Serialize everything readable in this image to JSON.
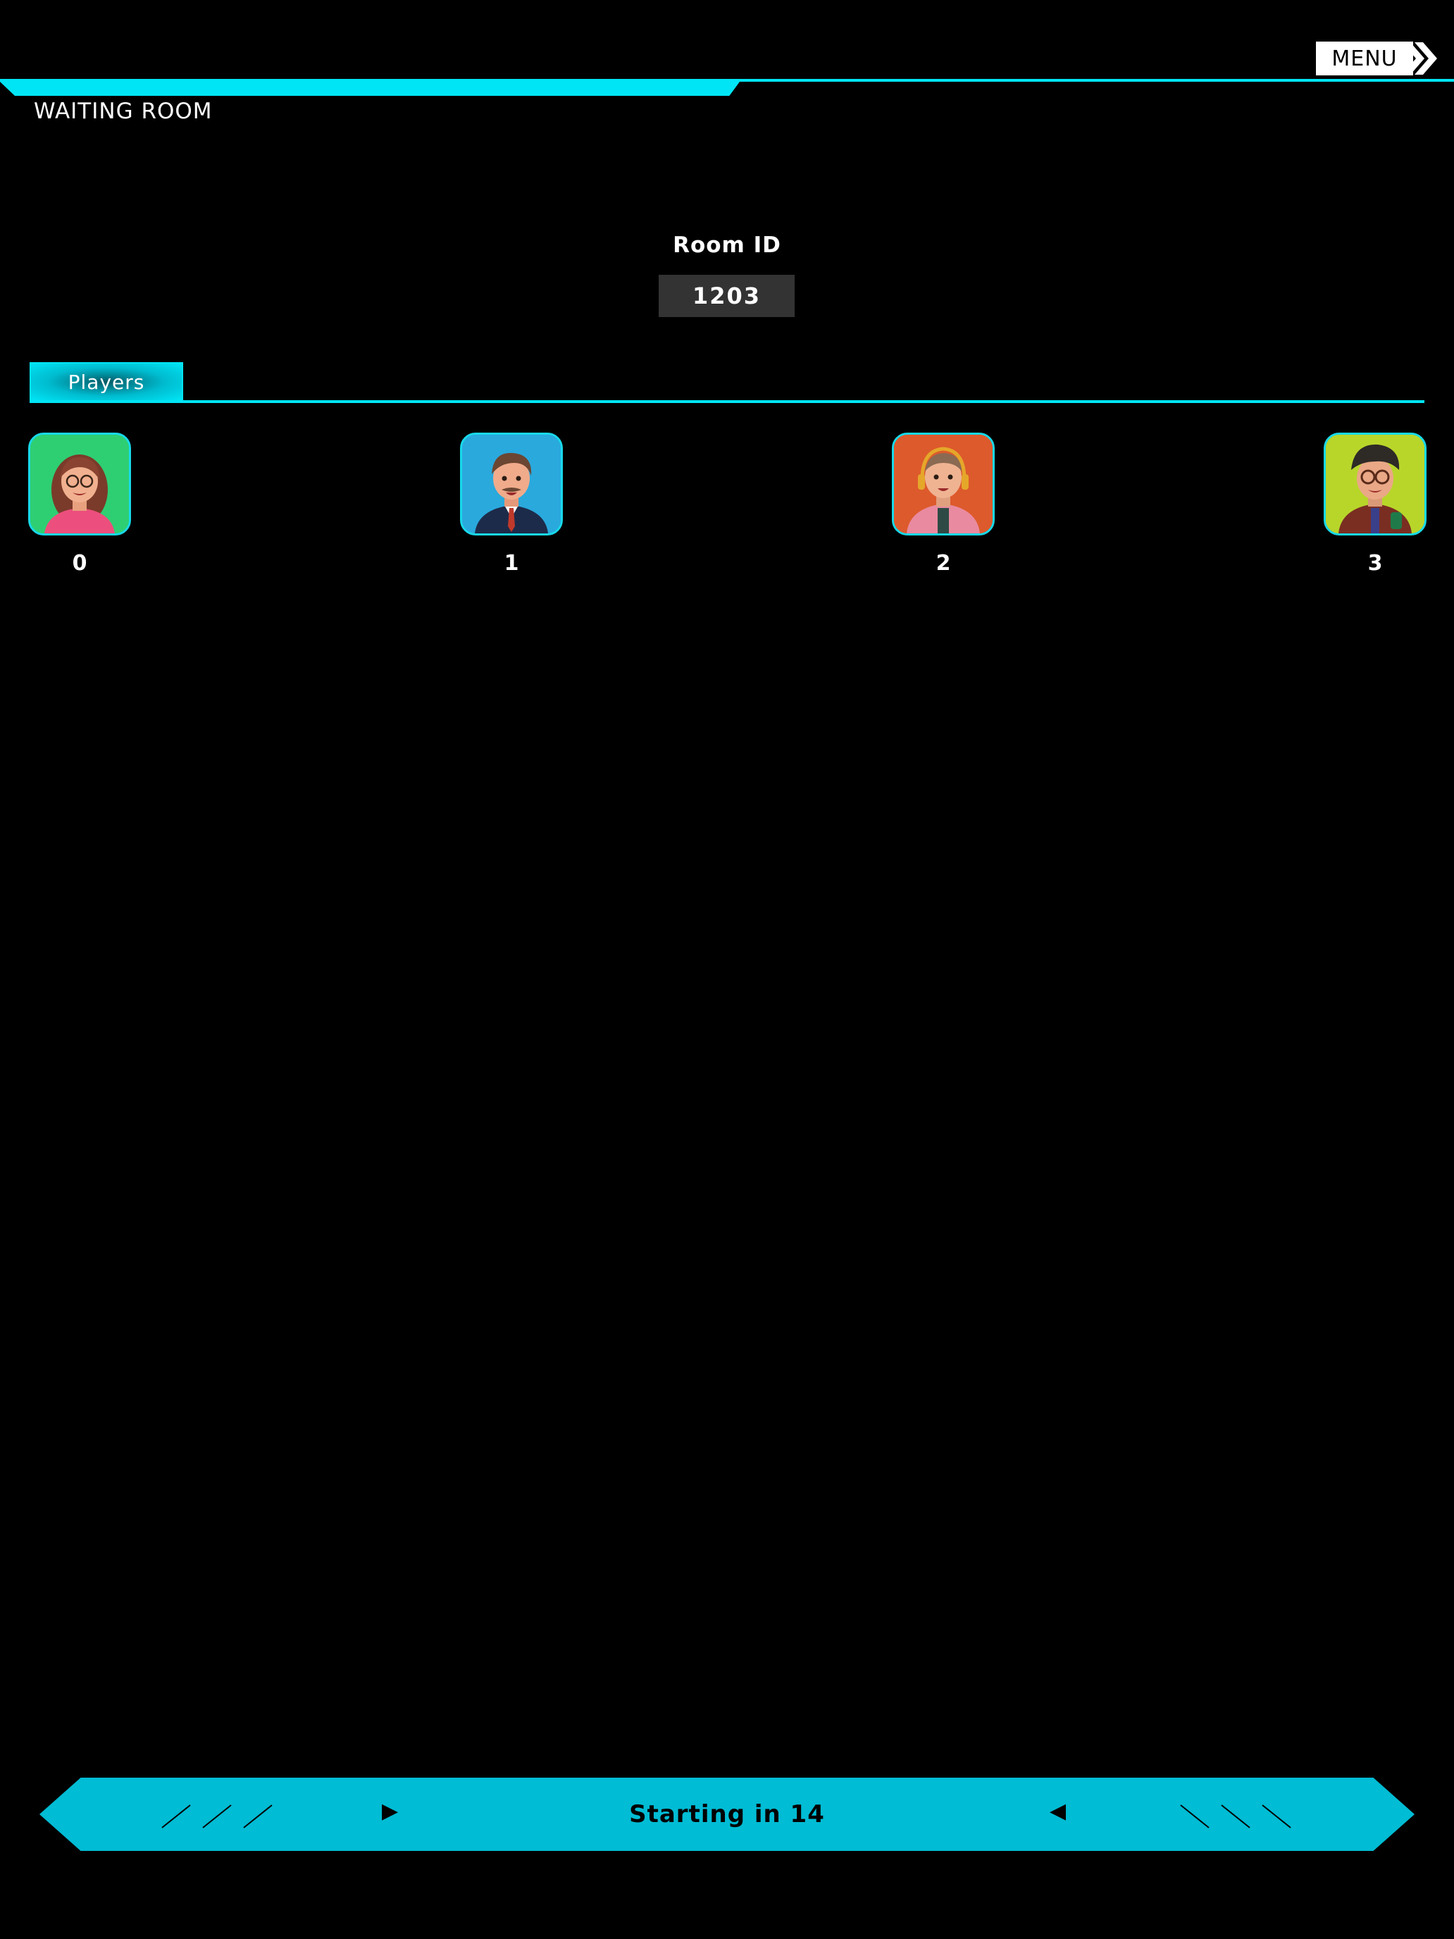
{
  "header": {
    "title": "WAITING ROOM",
    "menu_label": "MENU",
    "menu_icon": "double-chevron-right-icon"
  },
  "room": {
    "id_label": "Room ID",
    "id_value": "1203"
  },
  "players_tab": {
    "label": "Players"
  },
  "players": [
    {
      "name": "0",
      "avatar_bg": "#2ecf73",
      "avatar": "woman-glasses-avatar"
    },
    {
      "name": "1",
      "avatar_bg": "#2aa9dd",
      "avatar": "man-suit-avatar"
    },
    {
      "name": "2",
      "avatar_bg": "#dd5a2c",
      "avatar": "man-headphones-avatar"
    },
    {
      "name": "3",
      "avatar_bg": "#b8d62a",
      "avatar": "man-beanie-glasses-avatar"
    }
  ],
  "countdown": {
    "text": "Starting in 14"
  },
  "colors": {
    "accent": "#00e5f5",
    "banner": "#00bcd4",
    "background": "#000000",
    "room_id_box": "#333333"
  }
}
